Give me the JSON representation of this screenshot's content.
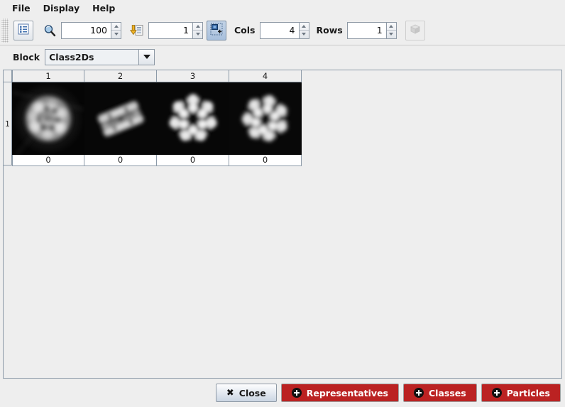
{
  "menu": {
    "items": [
      {
        "label": "File",
        "name": "menu-file"
      },
      {
        "label": "Display",
        "name": "menu-display"
      },
      {
        "label": "Help",
        "name": "menu-help"
      }
    ]
  },
  "toolbar": {
    "table_view_icon": "list-view-icon",
    "zoom_icon": "magnifier-icon",
    "zoom_value": "100",
    "goto_icon": "goto-row-icon",
    "goto_value": "1",
    "fit_icon": "resize-selection-icon",
    "cols_label": "Cols",
    "cols_value": "4",
    "rows_label": "Rows",
    "rows_value": "1",
    "volume_icon": "cube-icon"
  },
  "block": {
    "label": "Block",
    "selected": "Class2Ds"
  },
  "grid": {
    "row_headers": [
      "1"
    ],
    "column_headers": [
      "1",
      "2",
      "3",
      "4"
    ],
    "cells": [
      {
        "label": "0",
        "image": "class-average-1"
      },
      {
        "label": "0",
        "image": "class-average-2"
      },
      {
        "label": "0",
        "image": "class-average-3"
      },
      {
        "label": "0",
        "image": "class-average-4"
      }
    ]
  },
  "buttons": {
    "close": "Close",
    "representatives": "Representatives",
    "classes": "Classes",
    "particles": "Particles"
  },
  "colors": {
    "accent_red": "#bb2222",
    "panel": "#eeeeee",
    "border": "#8c9aa8"
  }
}
